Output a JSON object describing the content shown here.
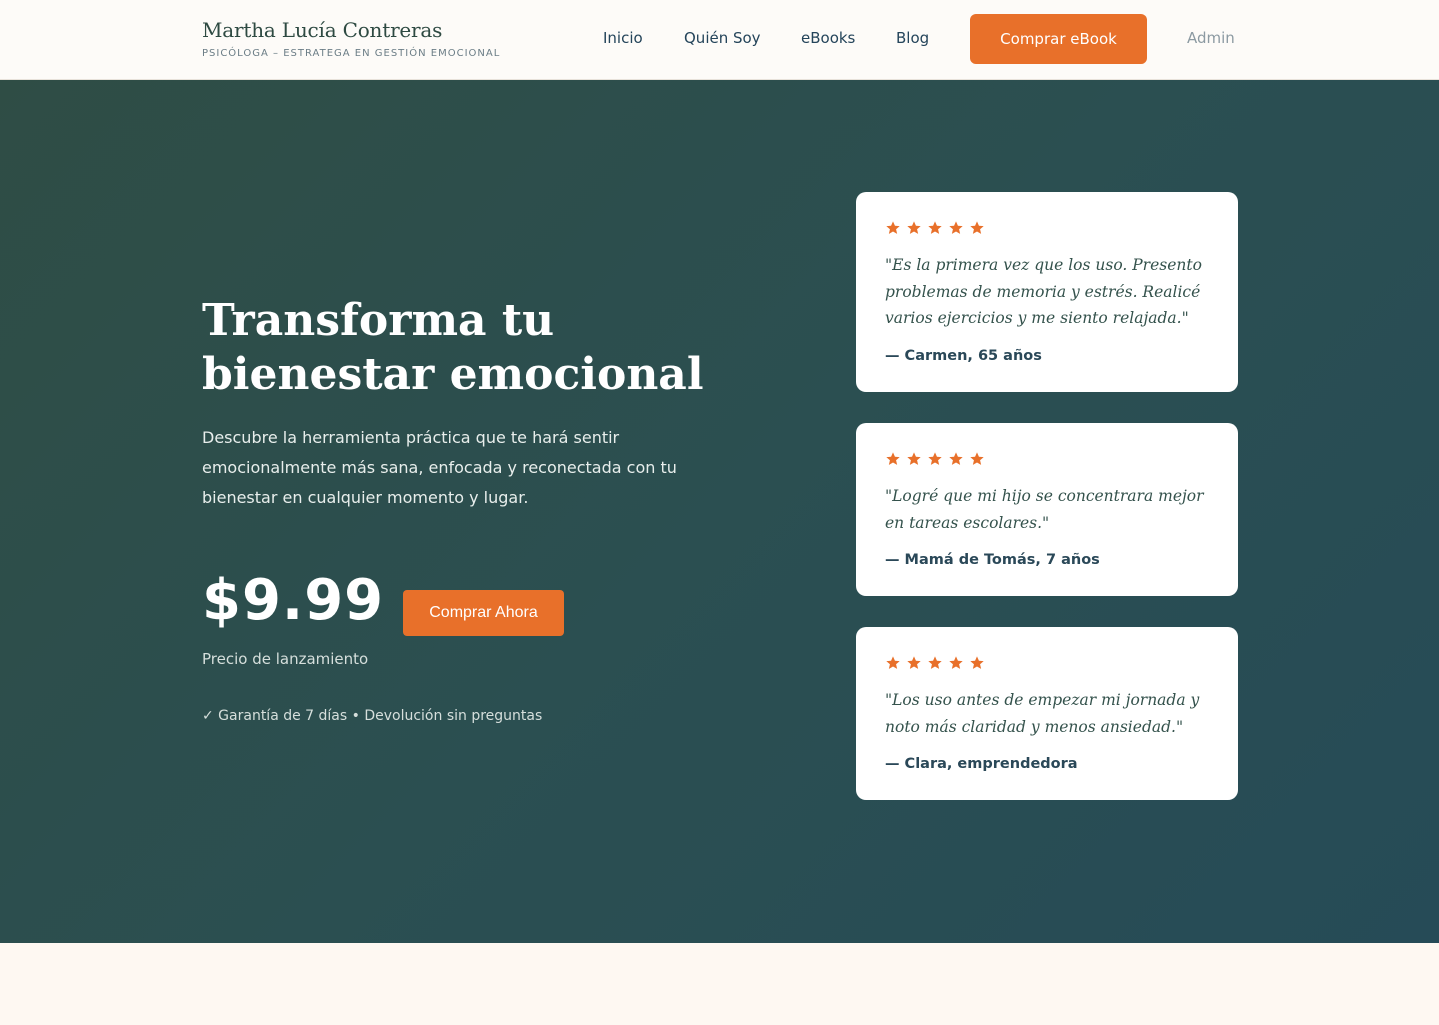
{
  "brand": {
    "name": "Martha Lucía Contreras",
    "tagline": "PSICÓLOGA – ESTRATEGA EN GESTIÓN EMOCIONAL"
  },
  "nav": {
    "items": [
      {
        "label": "Inicio"
      },
      {
        "label": "Quién Soy"
      },
      {
        "label": "eBooks"
      },
      {
        "label": "Blog"
      }
    ],
    "cta_label": "Comprar eBook",
    "admin_label": "Admin"
  },
  "hero": {
    "title": "Transforma tu bienestar emocional",
    "subtitle": "Descubre la herramienta práctica que te hará sentir emocionalmente más sana, enfocada y reconectada con tu bienestar en cualquier momento y lugar.",
    "price": "$9.99",
    "buy_label": "Comprar Ahora",
    "price_note": "Precio de lanzamiento",
    "guarantee": "✓ Garantía de 7 días • Devolución sin preguntas"
  },
  "testimonials": [
    {
      "rating": 5,
      "quote": "\"Es la primera vez que los uso. Presento problemas de memoria y estrés. Realicé varios ejercicios y me siento relajada.\"",
      "author": "— Carmen, 65 años"
    },
    {
      "rating": 5,
      "quote": "\"Logré que mi hijo se concentrara mejor en tareas escolares.\"",
      "author": "— Mamá de Tomás, 7 años"
    },
    {
      "rating": 5,
      "quote": "\"Los uso antes de empezar mi jornada y noto más claridad y menos ansiedad.\"",
      "author": "— Clara, emprendedora"
    }
  ],
  "colors": {
    "accent": "#e8702a",
    "hero_bg": "#2b4f4d",
    "text_dark": "#2a4858"
  },
  "icons": {
    "rating": "star-icon"
  }
}
